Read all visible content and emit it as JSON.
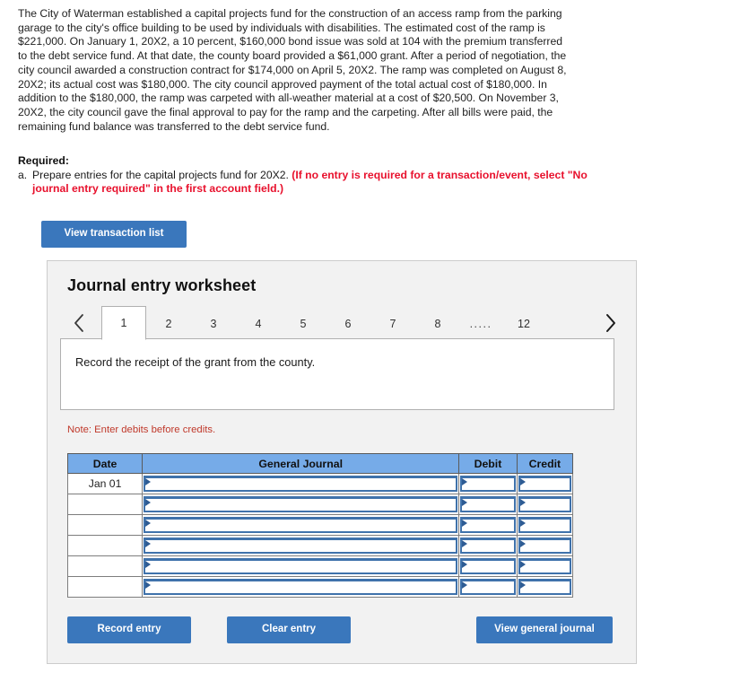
{
  "narrative": "The City of Waterman established a capital projects fund for the construction of an access ramp from the parking garage to the city's office building to be used by individuals with disabilities. The estimated cost of the ramp is $221,000. On January 1, 20X2, a 10 percent, $160,000 bond issue was sold at 104 with the premium transferred to the debt service fund. At that date, the county board provided a $61,000 grant. After a period of negotiation, the city council awarded a construction contract for $174,000 on April 5, 20X2. The ramp was completed on August 8, 20X2; its actual cost was $180,000. The city council approved payment of the total actual cost of $180,000. In addition to the $180,000, the ramp was carpeted with all-weather material at a cost of $20,500. On November 3, 20X2, the city council gave the final approval to pay for the ramp and the carpeting. After all bills were paid, the remaining fund balance was transferred to the debt service fund.",
  "required": {
    "heading": "Required:",
    "item_marker": "a.",
    "item_text": "Prepare entries for the capital projects fund for 20X2. ",
    "item_text_red": "(If no entry is required for a transaction/event, select \"No journal entry required\" in the first account field.)"
  },
  "buttons": {
    "view_transaction_list": "View transaction list",
    "record_entry": "Record entry",
    "clear_entry": "Clear entry",
    "view_general_journal": "View general journal"
  },
  "worksheet": {
    "title": "Journal entry worksheet",
    "pager": {
      "prev_icon": "chevron-left-icon",
      "next_icon": "chevron-right-icon",
      "tabs": [
        "1",
        "2",
        "3",
        "4",
        "5",
        "6",
        "7",
        "8"
      ],
      "ellipsis": ".....",
      "last_tab": "12",
      "active_tab": "1"
    },
    "instruction": "Record the receipt of the grant from the county.",
    "note": "Note: Enter debits before credits.",
    "table": {
      "columns": [
        "Date",
        "General Journal",
        "Debit",
        "Credit"
      ],
      "rows": [
        {
          "date": "Jan 01",
          "general_journal": "",
          "debit": "",
          "credit": ""
        },
        {
          "date": "",
          "general_journal": "",
          "debit": "",
          "credit": ""
        },
        {
          "date": "",
          "general_journal": "",
          "debit": "",
          "credit": ""
        },
        {
          "date": "",
          "general_journal": "",
          "debit": "",
          "credit": ""
        },
        {
          "date": "",
          "general_journal": "",
          "debit": "",
          "credit": ""
        },
        {
          "date": "",
          "general_journal": "",
          "debit": "",
          "credit": ""
        }
      ]
    }
  },
  "colors": {
    "button_blue": "#3a77bc",
    "table_header_blue": "#76abe8",
    "required_red": "#e8112d",
    "note_red": "#c0392b",
    "panel_gray": "#f2f2f2"
  }
}
